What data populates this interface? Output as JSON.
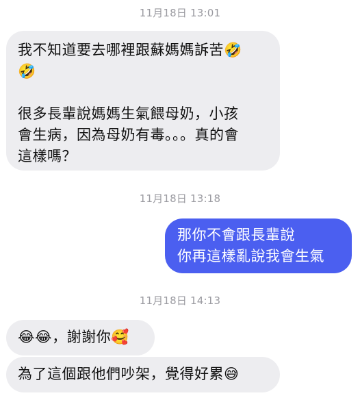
{
  "timestamps": [
    "11月18日 13:01",
    "11月18日 13:18",
    "11月18日 14:13"
  ],
  "messages": [
    {
      "sender": "incoming",
      "text": "我不知道要去哪裡跟蘇媽媽訴苦🤣\n🤣\n\n很多長輩說媽媽生氣餵母奶，小孩\n會生病，因為母奶有毒。。。真的會\n這樣嗎？"
    },
    {
      "sender": "outgoing",
      "text": "那你不會跟長輩說\n你再這樣亂說我會生氣"
    },
    {
      "sender": "incoming",
      "text": "😂😂，謝謝你🥰"
    },
    {
      "sender": "incoming",
      "text": "為了這個跟他們吵架，覺得好累😅"
    }
  ],
  "colors": {
    "incoming_bubble": "#ededf0",
    "outgoing_bubble": "#4b5ff0",
    "timestamp_text": "#9a9aa0"
  }
}
